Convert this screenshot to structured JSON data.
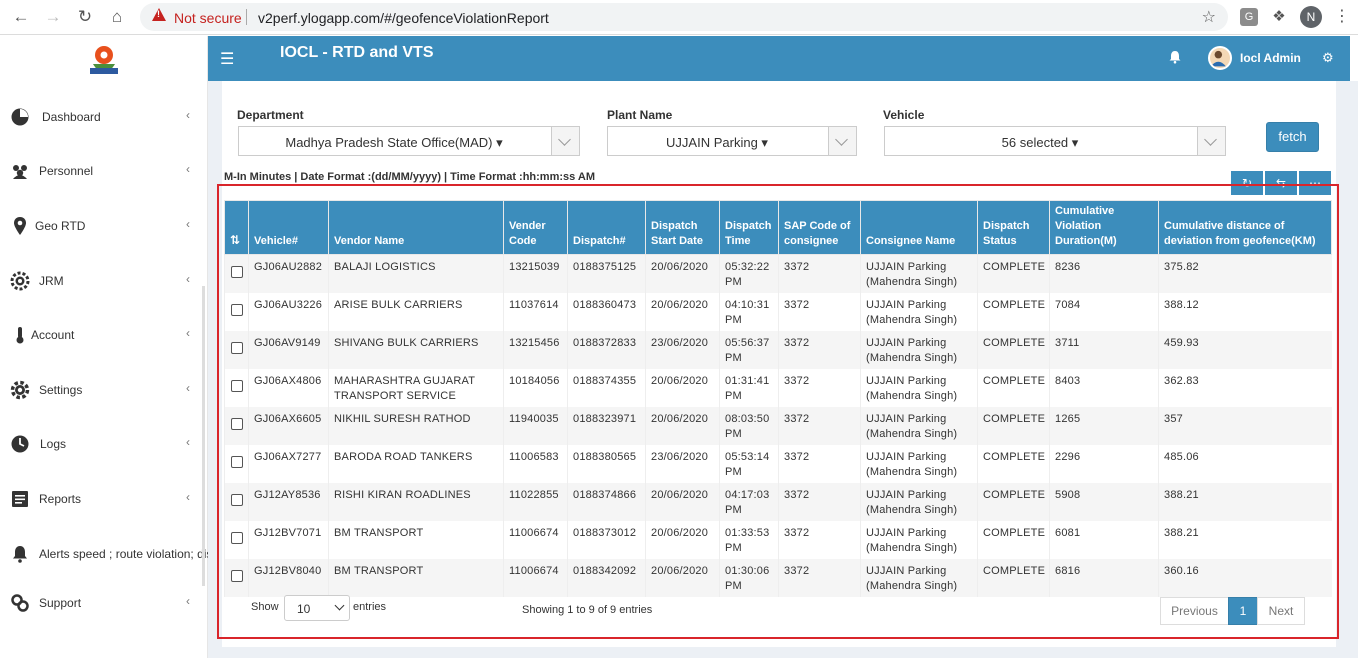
{
  "browser": {
    "security_label": "Not secure",
    "url": "v2perf.ylogapp.com/#/geofenceViolationReport",
    "profile_initial": "N",
    "ext_letter": "G"
  },
  "sidebar": {
    "items": [
      {
        "label": "Dashboard",
        "icon": "dashboard-icon"
      },
      {
        "label": "Personnel",
        "icon": "personnel-icon"
      },
      {
        "label": "Geo RTD",
        "icon": "map-pin-icon"
      },
      {
        "label": "JRM",
        "icon": "gear-icon"
      },
      {
        "label": "Account",
        "icon": "thermometer-icon"
      },
      {
        "label": "Settings",
        "icon": "settings-icon"
      },
      {
        "label": "Logs",
        "icon": "clock-icon"
      },
      {
        "label": "Reports",
        "icon": "report-icon"
      },
      {
        "label": "Alerts speed ; route violation; dis",
        "icon": "bell-icon"
      },
      {
        "label": "Support",
        "icon": "link-icon"
      }
    ]
  },
  "header": {
    "title": "IOCL - RTD and VTS",
    "user_name": "Iocl Admin"
  },
  "filters": {
    "department_label": "Department",
    "department_value": "Madhya Pradesh State Office(MAD)",
    "plant_label": "Plant Name",
    "plant_value": "UJJAIN Parking",
    "vehicle_label": "Vehicle",
    "vehicle_value": "56 selected",
    "fetch_label": "fetch"
  },
  "format_note": "M-In Minutes | Date Format :(dd/MM/yyyy) | Time Format :hh:mm:ss AM",
  "table": {
    "headers": [
      "",
      "Vehicle#",
      "Vendor Name",
      "Vender Code",
      "Dispatch#",
      "Dispatch Start Date",
      "Dispatch Time",
      "SAP Code of consignee",
      "Consignee Name",
      "Dispatch Status",
      "Cumulative Violation Duration(M)",
      "Cumulative distance of deviation from geofence(KM)"
    ],
    "rows": [
      [
        "GJ06AU2882",
        "BALAJI LOGISTICS",
        "13215039",
        "0188375125",
        "20/06/2020",
        "05:32:22 PM",
        "3372",
        "UJJAIN Parking (Mahendra Singh)",
        "COMPLETE",
        "8236",
        "375.82"
      ],
      [
        "GJ06AU3226",
        "ARISE BULK CARRIERS",
        "11037614",
        "0188360473",
        "20/06/2020",
        "04:10:31 PM",
        "3372",
        "UJJAIN Parking (Mahendra Singh)",
        "COMPLETE",
        "7084",
        "388.12"
      ],
      [
        "GJ06AV9149",
        "SHIVANG BULK CARRIERS",
        "13215456",
        "0188372833",
        "23/06/2020",
        "05:56:37 PM",
        "3372",
        "UJJAIN Parking (Mahendra Singh)",
        "COMPLETE",
        "3711",
        "459.93"
      ],
      [
        "GJ06AX4806",
        "MAHARASHTRA GUJARAT TRANSPORT SERVICE",
        "10184056",
        "0188374355",
        "20/06/2020",
        "01:31:41 PM",
        "3372",
        "UJJAIN Parking (Mahendra Singh)",
        "COMPLETE",
        "8403",
        "362.83"
      ],
      [
        "GJ06AX6605",
        "NIKHIL SURESH RATHOD",
        "11940035",
        "0188323971",
        "20/06/2020",
        "08:03:50 PM",
        "3372",
        "UJJAIN Parking (Mahendra Singh)",
        "COMPLETE",
        "1265",
        "357"
      ],
      [
        "GJ06AX7277",
        "BARODA ROAD TANKERS",
        "11006583",
        "0188380565",
        "23/06/2020",
        "05:53:14 PM",
        "3372",
        "UJJAIN Parking (Mahendra Singh)",
        "COMPLETE",
        "2296",
        "485.06"
      ],
      [
        "GJ12AY8536",
        "RISHI KIRAN ROADLINES",
        "11022855",
        "0188374866",
        "20/06/2020",
        "04:17:03 PM",
        "3372",
        "UJJAIN Parking (Mahendra Singh)",
        "COMPLETE",
        "5908",
        "388.21"
      ],
      [
        "GJ12BV7071",
        "BM TRANSPORT",
        "11006674",
        "0188373012",
        "20/06/2020",
        "01:33:53 PM",
        "3372",
        "UJJAIN Parking (Mahendra Singh)",
        "COMPLETE",
        "6081",
        "388.21"
      ],
      [
        "GJ12BV8040",
        "BM TRANSPORT",
        "11006674",
        "0188342092",
        "20/06/2020",
        "01:30:06 PM",
        "3372",
        "UJJAIN Parking (Mahendra Singh)",
        "COMPLETE",
        "6816",
        "360.16"
      ]
    ]
  },
  "footer": {
    "show_label": "Show",
    "page_size": "10",
    "entries_label": "entries",
    "showing_text": "Showing 1 to 9 of 9 entries",
    "prev_label": "Previous",
    "page_number": "1",
    "next_label": "Next"
  },
  "colors": {
    "accent": "#3c8dbc",
    "highlight_frame": "#d9252b"
  }
}
